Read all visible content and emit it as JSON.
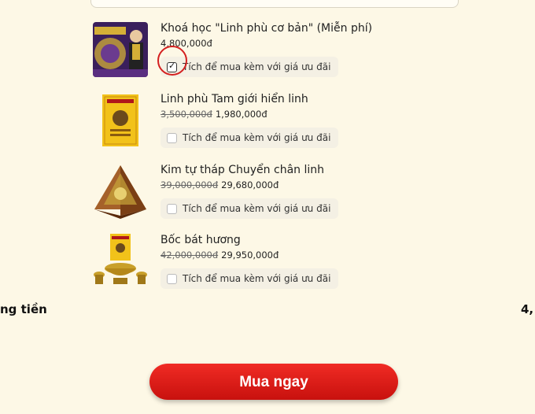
{
  "products": [
    {
      "name": "Khoá học \"Linh phù cơ bản\" (Miễn phí)",
      "old_price": "",
      "price": "4,800,000đ",
      "addon_label": "Tích để mua kèm với giá ưu đãi",
      "checked": true
    },
    {
      "name": "Linh phù Tam giới hiển linh",
      "old_price": "3,500,000đ",
      "price": "1,980,000đ",
      "addon_label": "Tích để mua kèm với giá ưu đãi",
      "checked": false
    },
    {
      "name": "Kim tự tháp Chuyển chân linh",
      "old_price": "39,000,000đ",
      "price": "29,680,000đ",
      "addon_label": "Tích để mua kèm với giá ưu đãi",
      "checked": false
    },
    {
      "name": "Bốc bát hương",
      "old_price": "42,000,000đ",
      "price": "29,950,000đ",
      "addon_label": "Tích để mua kèm với giá ưu đãi",
      "checked": false
    }
  ],
  "total": {
    "label": "ng tiền",
    "value": "4,"
  },
  "buy_button_label": "Mua ngay",
  "colors": {
    "accent": "#e01a16",
    "background": "#fdf8e6"
  }
}
